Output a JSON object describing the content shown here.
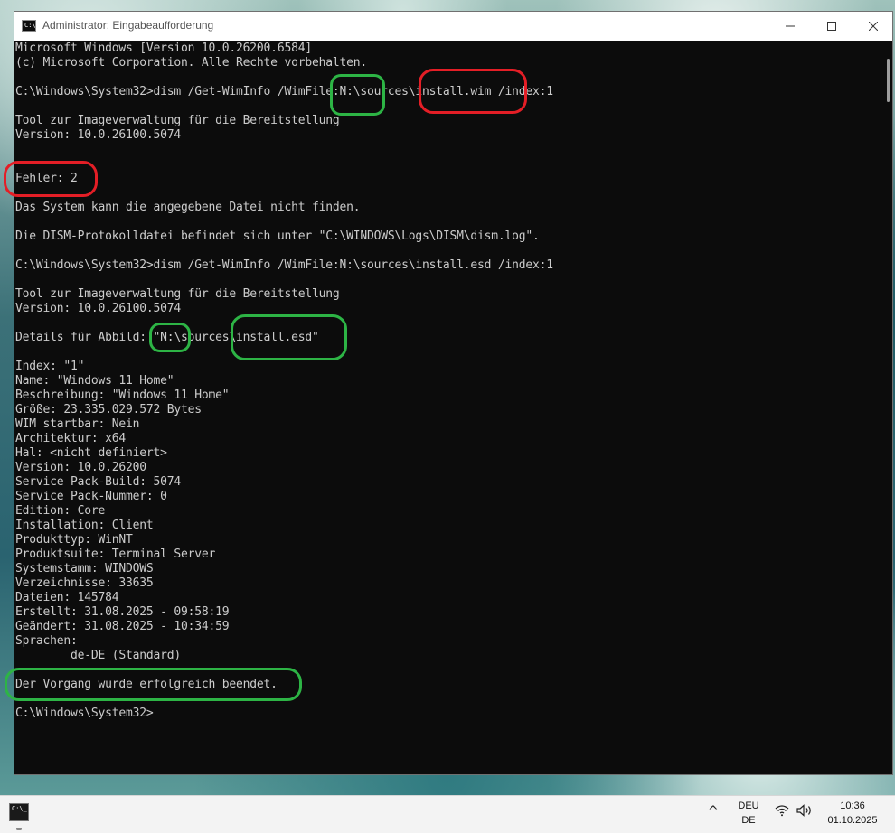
{
  "window": {
    "icon_label": "C:\\_",
    "title": "Administrator: Eingabeaufforderung",
    "minimize_icon": "minimize-icon",
    "maximize_icon": "maximize-icon",
    "close_icon": "close-icon"
  },
  "console_lines": [
    "Microsoft Windows [Version 10.0.26200.6584]",
    "(c) Microsoft Corporation. Alle Rechte vorbehalten.",
    "",
    "C:\\Windows\\System32>dism /Get-WimInfo /WimFile:N:\\sources\\install.wim /index:1",
    "",
    "Tool zur Imageverwaltung für die Bereitstellung",
    "Version: 10.0.26100.5074",
    "",
    "",
    "Fehler: 2",
    "",
    "Das System kann die angegebene Datei nicht finden.",
    "",
    "Die DISM-Protokolldatei befindet sich unter \"C:\\WINDOWS\\Logs\\DISM\\dism.log\".",
    "",
    "C:\\Windows\\System32>dism /Get-WimInfo /WimFile:N:\\sources\\install.esd /index:1",
    "",
    "Tool zur Imageverwaltung für die Bereitstellung",
    "Version: 10.0.26100.5074",
    "",
    "Details für Abbild: \"N:\\sources\\install.esd\"",
    "",
    "Index: \"1\"",
    "Name: \"Windows 11 Home\"",
    "Beschreibung: \"Windows 11 Home\"",
    "Größe: 23.335.029.572 Bytes",
    "WIM startbar: Nein",
    "Architektur: x64",
    "Hal: <nicht definiert>",
    "Version: 10.0.26200",
    "Service Pack-Build: 5074",
    "Service Pack-Nummer: 0",
    "Edition: Core",
    "Installation: Client",
    "Produkttyp: WinNT",
    "Produktsuite: Terminal Server",
    "Systemstamm: WINDOWS",
    "Verzeichnisse: 33635",
    "Dateien: 145784",
    "Erstellt: 31.08.2025 - 09:58:19",
    "Geändert: 31.08.2025 - 10:34:59",
    "Sprachen:",
    "        de-DE (Standard)",
    "",
    "Der Vorgang wurde erfolgreich beendet.",
    "",
    "C:\\Windows\\System32>"
  ],
  "annotations": {
    "red_color": "#e41e26",
    "green_color": "#2db445"
  },
  "taskbar": {
    "app_icon": "command-prompt-icon",
    "tray_chevron": "^",
    "lang_line1": "DEU",
    "lang_line2": "DE",
    "network_icon": "wifi-icon",
    "volume_icon": "speaker-icon",
    "time": "10:36",
    "date": "01.10.2025"
  }
}
